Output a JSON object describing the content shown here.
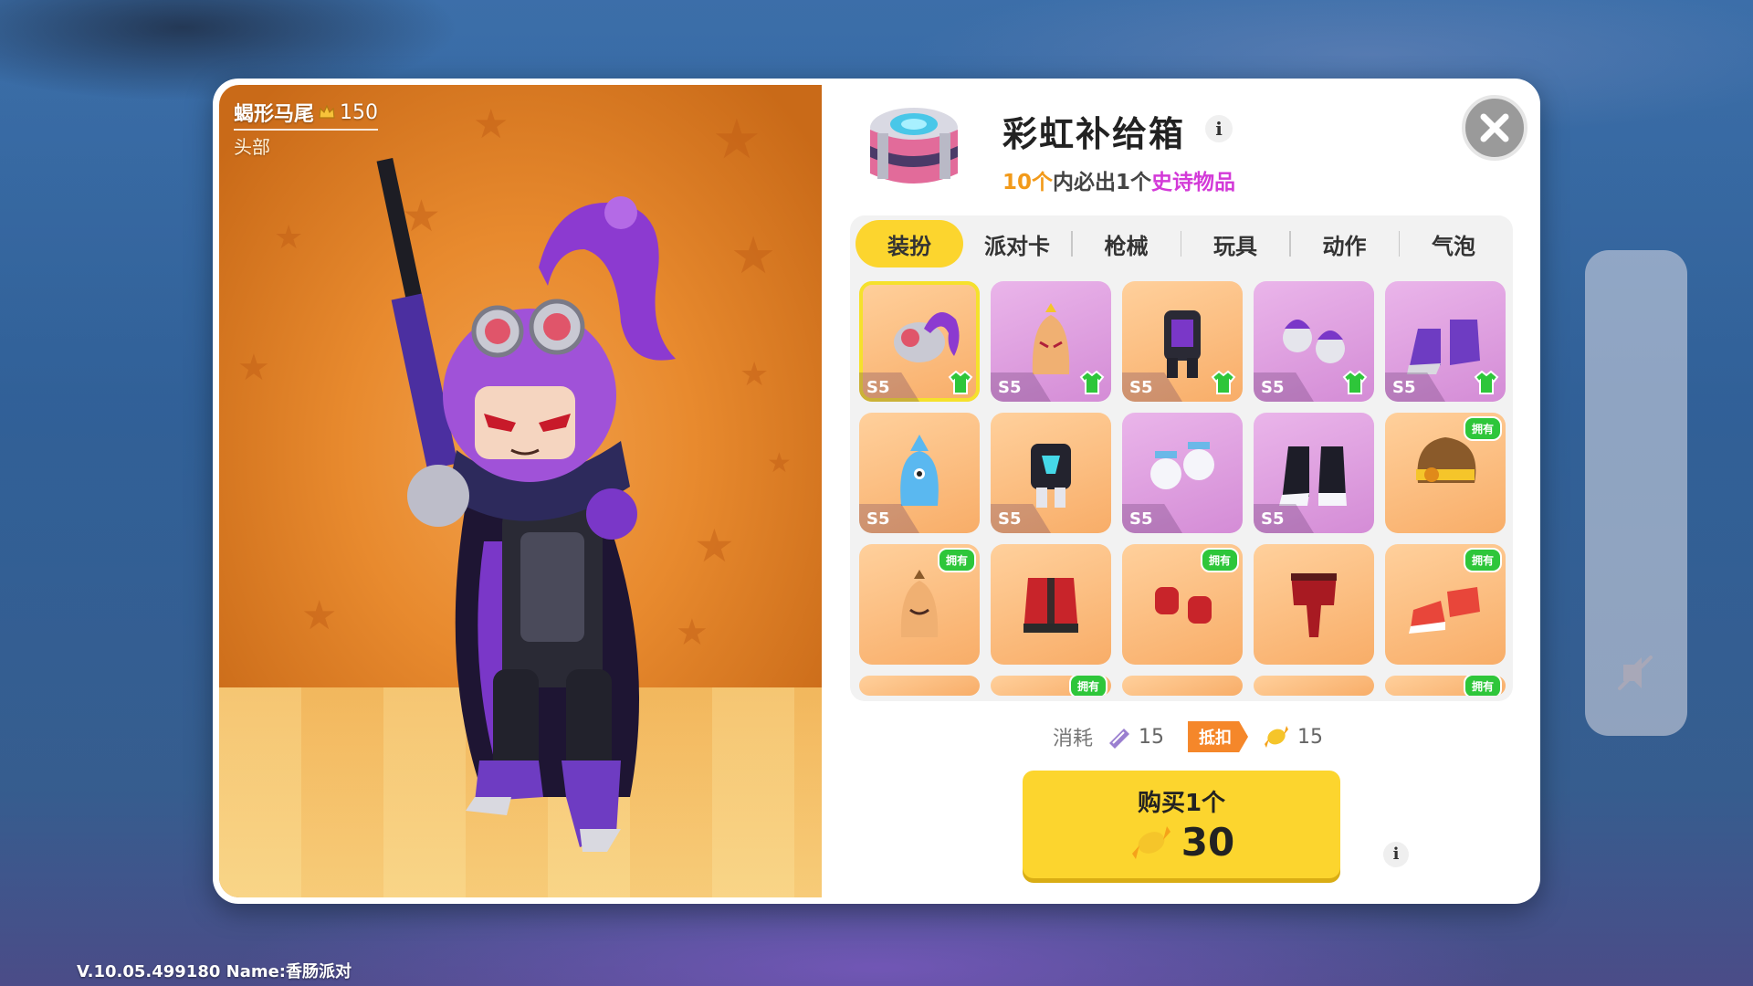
{
  "preview": {
    "item_name": "蝎形马尾",
    "item_price": "150",
    "item_slot": "头部"
  },
  "header": {
    "title": "彩虹补给箱",
    "info_glyph": "i",
    "guarantee_num": "10个",
    "guarantee_mid": "内必出1个",
    "guarantee_epic": "史诗物品"
  },
  "tabs": [
    {
      "label": "装扮",
      "active": true
    },
    {
      "label": "派对卡"
    },
    {
      "label": "枪械"
    },
    {
      "label": "玩具"
    },
    {
      "label": "动作"
    },
    {
      "label": "气泡"
    }
  ],
  "grid": {
    "s5_label": "S5",
    "owned_label": "拥有",
    "items": [
      {
        "name": "scorpion-ponytail",
        "bg": "orange",
        "s5": true,
        "upgrade": true,
        "selected": true
      },
      {
        "name": "angry-bean-purple",
        "bg": "purple",
        "s5": true,
        "upgrade": true
      },
      {
        "name": "dark-armor-outfit",
        "bg": "orange",
        "s5": true,
        "upgrade": true
      },
      {
        "name": "purple-gloves",
        "bg": "purple",
        "s5": true,
        "upgrade": true
      },
      {
        "name": "purple-boots",
        "bg": "purple",
        "s5": true,
        "upgrade": true
      },
      {
        "name": "blue-blob-backpack",
        "bg": "orange",
        "s5": true
      },
      {
        "name": "dark-cyber-outfit",
        "bg": "orange",
        "s5": true
      },
      {
        "name": "white-gloves",
        "bg": "purple",
        "s5": true
      },
      {
        "name": "black-white-boots",
        "bg": "purple",
        "s5": true
      },
      {
        "name": "spiky-hair-goggles",
        "bg": "orange",
        "owned": true
      },
      {
        "name": "smiling-bean",
        "bg": "orange",
        "owned": true
      },
      {
        "name": "red-jacket",
        "bg": "orange"
      },
      {
        "name": "red-gloves",
        "bg": "orange",
        "owned": true
      },
      {
        "name": "red-pants",
        "bg": "orange"
      },
      {
        "name": "red-sneakers",
        "bg": "orange",
        "owned": true
      },
      {
        "name": "partial-1",
        "bg": "orange"
      },
      {
        "name": "partial-2",
        "bg": "orange",
        "owned": true
      },
      {
        "name": "partial-3",
        "bg": "orange"
      },
      {
        "name": "partial-4",
        "bg": "orange"
      },
      {
        "name": "partial-5",
        "bg": "orange",
        "owned": true
      }
    ]
  },
  "cost": {
    "label": "消耗",
    "ticket_amount": "15",
    "deduct_label": "抵扣",
    "candy_amount": "15"
  },
  "buy": {
    "label": "购买1个",
    "price": "30"
  },
  "footer": {
    "version": "V.10.05.499180 Name:香肠派对"
  },
  "colors": {
    "accent_yellow": "#fcd52e",
    "epic_purple": "#d33ad8",
    "owned_green": "#2ec63a",
    "deduct_orange": "#f5872a"
  }
}
